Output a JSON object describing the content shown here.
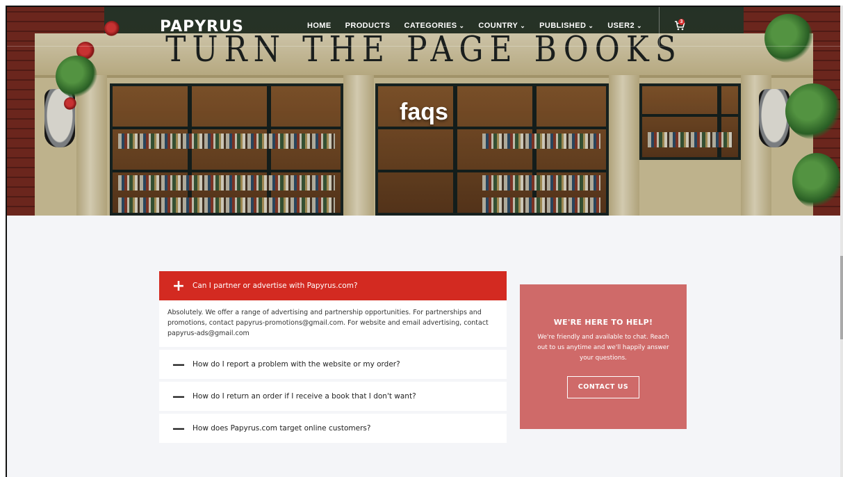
{
  "brand": {
    "logo_text": "PAPYRUS"
  },
  "nav": {
    "items": [
      {
        "label": "HOME",
        "dropdown": false
      },
      {
        "label": "PRODUCTS",
        "dropdown": false
      },
      {
        "label": "CATEGORIES",
        "dropdown": true
      },
      {
        "label": "COUNTRY",
        "dropdown": true
      },
      {
        "label": "PUBLISHED",
        "dropdown": true
      },
      {
        "label": "USER2",
        "dropdown": true
      }
    ],
    "cart_count": "3"
  },
  "hero": {
    "sign_text": "TURN THE PAGE BOOKS",
    "page_title": "faqs"
  },
  "faq": {
    "items": [
      {
        "question": "Can I partner or advertise with Papyrus.com?",
        "answer": "Absolutely. We offer a range of advertising and partnership opportunities. For partnerships and promotions, contact papyrus-promotions@gmail.com. For website and email advertising, contact papyrus-ads@gmail.com",
        "expanded": true
      },
      {
        "question": "How do I report a problem with the website or my order?",
        "expanded": false
      },
      {
        "question": "How do I return an order if I receive a book that I don't want?",
        "expanded": false
      },
      {
        "question": "How does Papyrus.com target online customers?",
        "expanded": false
      }
    ]
  },
  "help": {
    "title": "WE'RE HERE TO HELP!",
    "text": "We're friendly and available to chat. Reach out to us anytime and we'll happily answer your questions.",
    "button_label": "CONTACT US"
  },
  "colors": {
    "accent_red": "#d32a21",
    "help_box": "#cf6a69",
    "page_bg": "#f4f5f8"
  }
}
